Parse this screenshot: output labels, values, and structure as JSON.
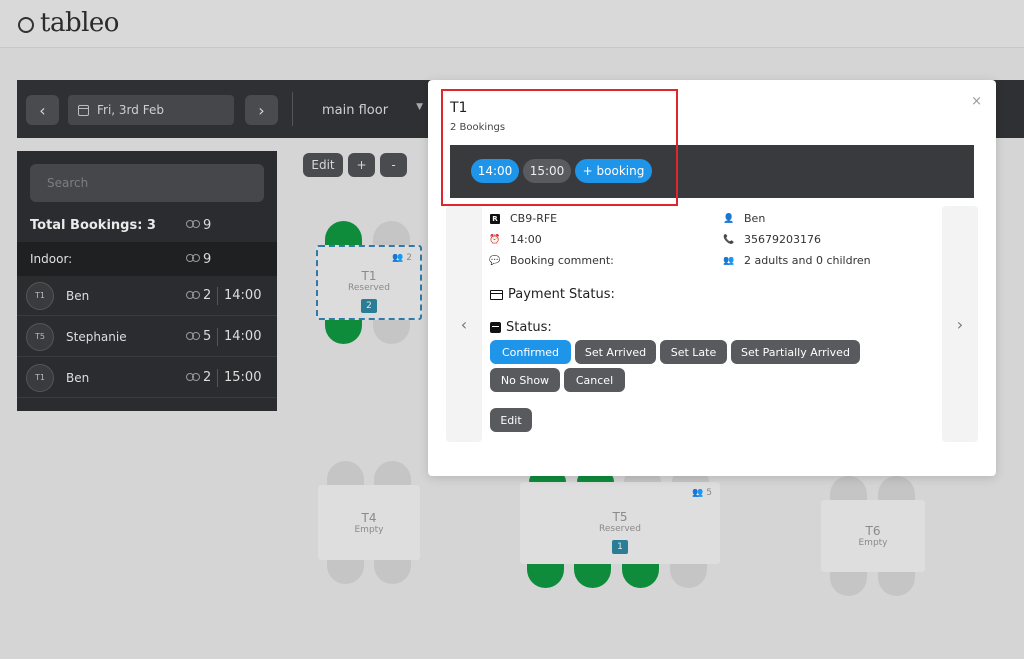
{
  "app": {
    "logo_text": "tableo"
  },
  "toolbar": {
    "prev_glyph": "‹",
    "next_glyph": "›",
    "date": "Fri, 3rd Feb",
    "floor": "main floor"
  },
  "sidebar": {
    "search_placeholder": "Search",
    "total_label": "Total Bookings: 3",
    "total_guests": "9",
    "area_label": "Indoor:",
    "area_guests": "9",
    "bookings": [
      {
        "table": "T1",
        "name": "Ben",
        "guests": "2",
        "time": "14:00"
      },
      {
        "table": "T5",
        "name": "Stephanie",
        "guests": "5",
        "time": "14:00"
      },
      {
        "table": "T1",
        "name": "Ben",
        "guests": "2",
        "time": "15:00"
      }
    ]
  },
  "floor_controls": {
    "edit": "Edit",
    "zoom_in": "+",
    "zoom_out": "-"
  },
  "tables": {
    "t1": {
      "name": "T1",
      "status": "Reserved",
      "count": "2",
      "capacity": "2"
    },
    "t4": {
      "name": "T4",
      "status": "Empty"
    },
    "t5": {
      "name": "T5",
      "status": "Reserved",
      "count": "1",
      "capacity": "5"
    },
    "t6": {
      "name": "T6",
      "status": "Empty"
    }
  },
  "modal": {
    "close": "×",
    "title": "T1",
    "subtitle": "2 Bookings",
    "slots": [
      "14:00",
      "15:00"
    ],
    "add_booking": "+ booking",
    "prev": "‹",
    "next": "›",
    "booking": {
      "reference": "CB9-RFE",
      "time": "14:00",
      "comment_label": "Booking comment:",
      "guest_name": "Ben",
      "phone": "35679203176",
      "party": "2 adults and 0 children"
    },
    "payment_label": "Payment Status:",
    "status_label": "Status:",
    "status_buttons": [
      "Confirmed",
      "Set Arrived",
      "Set Late",
      "Set Partially Arrived",
      "No Show",
      "Cancel"
    ],
    "edit": "Edit"
  },
  "colors": {
    "accent": "#1f95ea",
    "seat_green": "#0f8c3b",
    "highlight": "#e0262d"
  }
}
